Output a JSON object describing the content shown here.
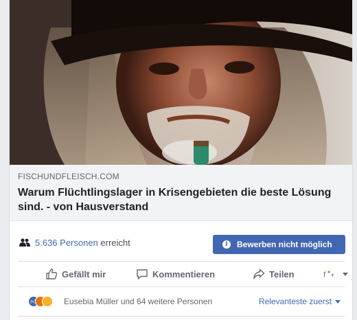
{
  "link": {
    "domain": "FISCHUNDFLEISCH.COM",
    "title": "Warum Flüchtlingslager in Krisengebieten die beste Lösung sind. - von Hausverstand"
  },
  "reach": {
    "count_link": "5.636 Personen",
    "suffix": "erreicht"
  },
  "boost_button": {
    "label": "Bewerben nicht möglich"
  },
  "actions": {
    "like": "Gefällt mir",
    "comment": "Kommentieren",
    "share": "Teilen"
  },
  "reactions": {
    "summary": "Eusebia Müller und 64 weitere Personen",
    "sort_label": "Relevanteste zuerst"
  },
  "colors": {
    "brand": "#4267b2",
    "like_reaction": "#4267b2",
    "angry_reaction": "#e9710f",
    "sad_reaction": "#f7b125"
  },
  "icons": {
    "like": "thumbs-up-icon",
    "comment": "speech-bubble-icon",
    "share": "share-arrow-icon",
    "reach": "people-icon",
    "info": "info-icon"
  }
}
